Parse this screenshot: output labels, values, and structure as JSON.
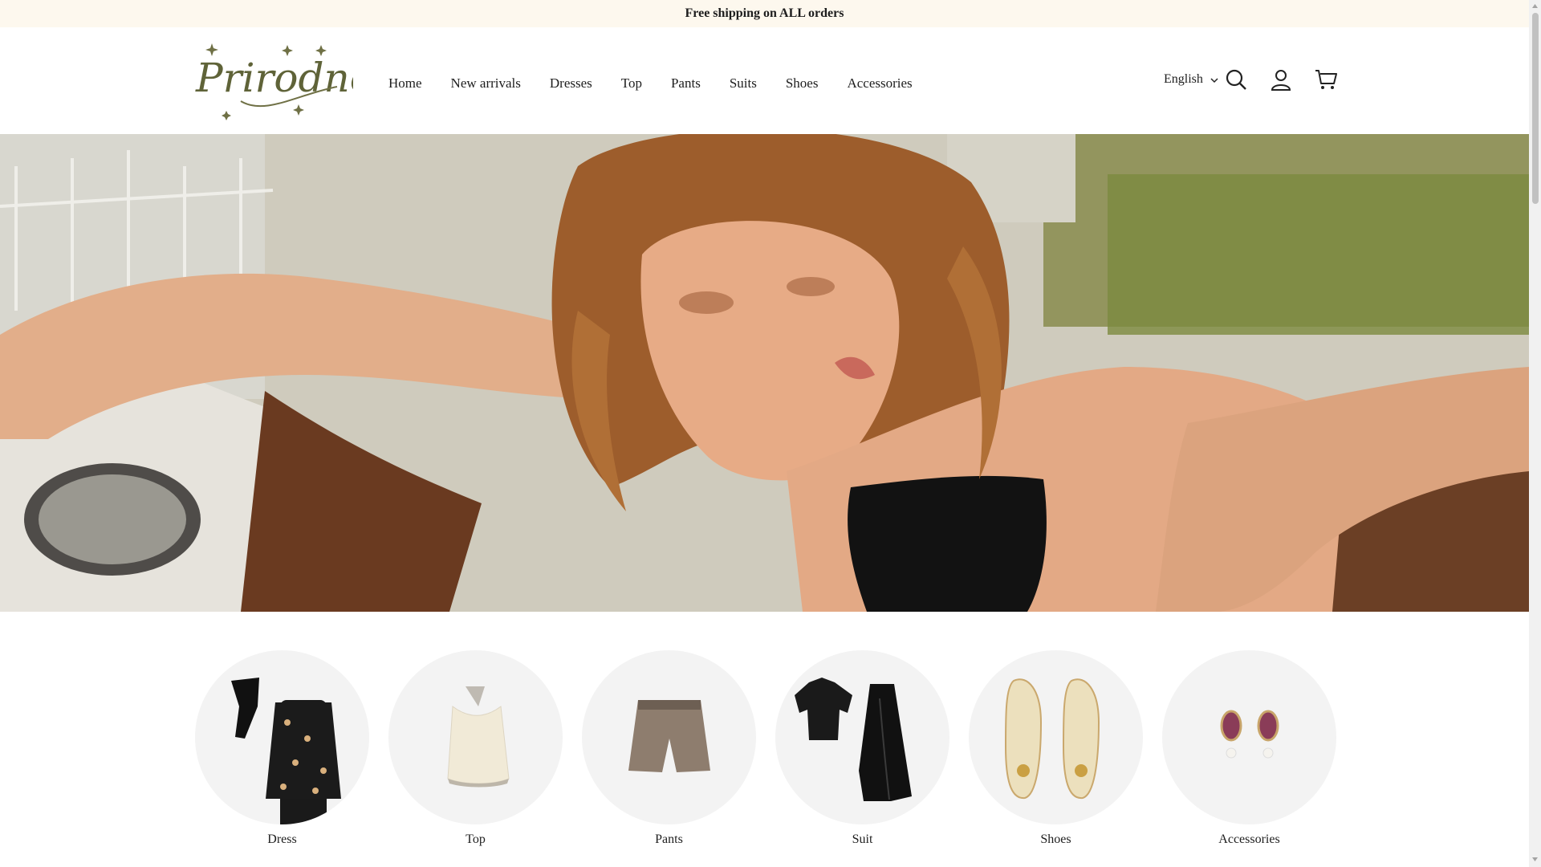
{
  "announcement": "Free shipping on ALL orders",
  "brand": {
    "name": "Prirodne"
  },
  "nav": [
    "Home",
    "New arrivals",
    "Dresses",
    "Top",
    "Pants",
    "Suits",
    "Shoes",
    "Accessories"
  ],
  "tools": {
    "language": "English",
    "icons": [
      "search-icon",
      "account-icon",
      "cart-icon"
    ]
  },
  "hero": {
    "alt": "hero-banner"
  },
  "categories": [
    "Dress",
    "Top",
    "Pants",
    "Suit",
    "Shoes",
    "Accessories"
  ],
  "colors": {
    "announce_bg": "#fdf8ee",
    "brand_text": "#5f6338",
    "circle_bg": "#f3f3f3"
  }
}
